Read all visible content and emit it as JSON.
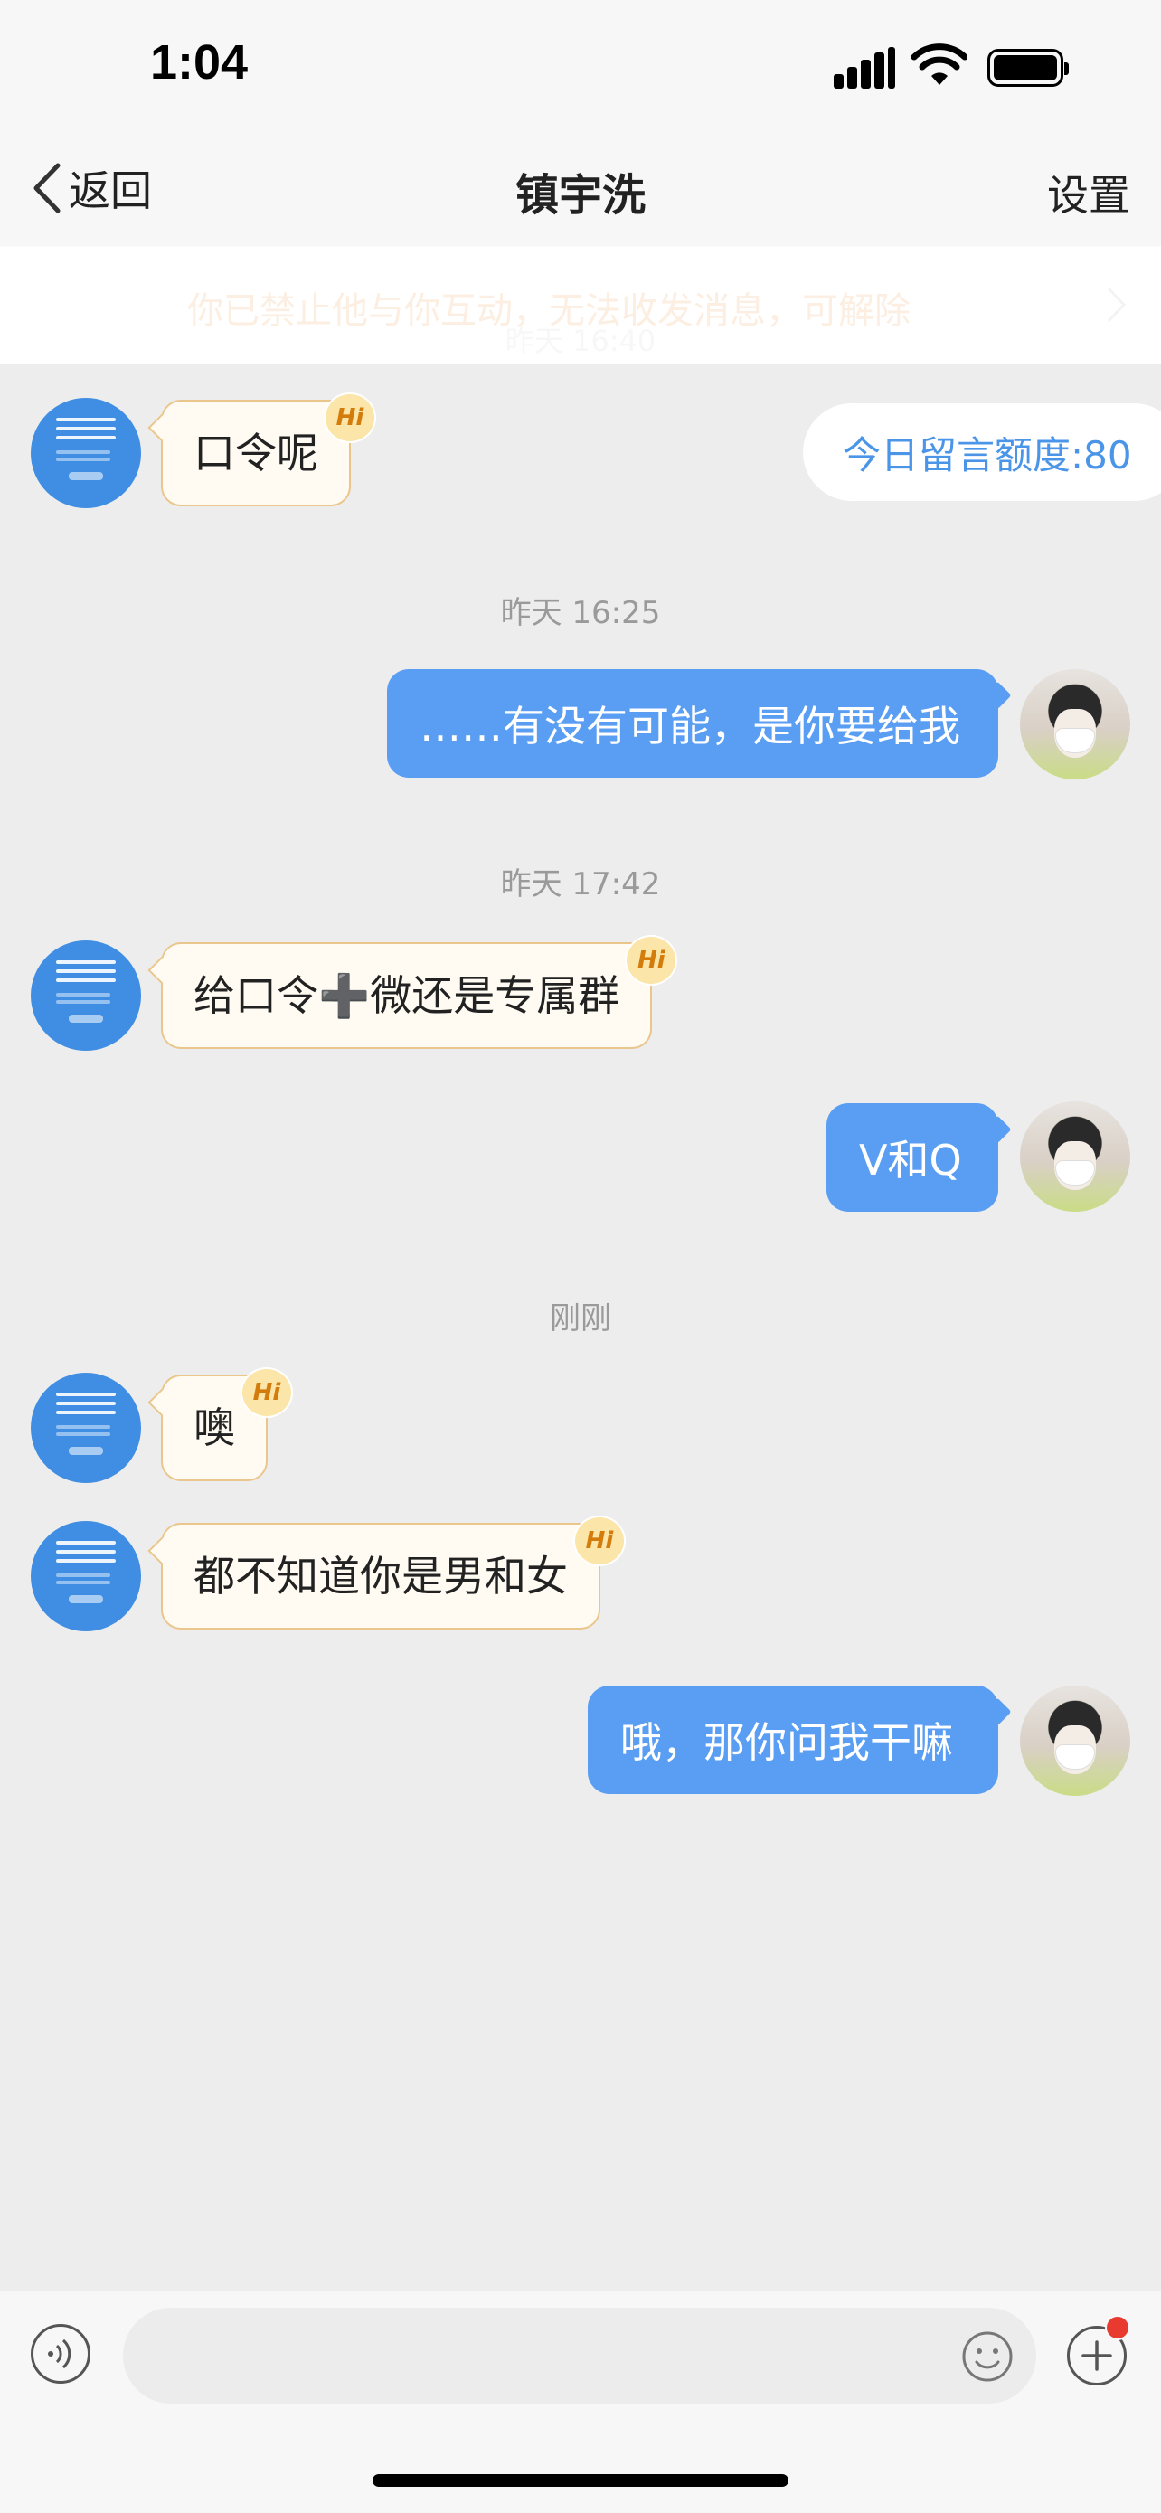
{
  "status_bar": {
    "time": "1:04",
    "icons": [
      "signal-icon",
      "wifi-icon",
      "battery-icon"
    ]
  },
  "nav": {
    "back_label": "返回",
    "title": "镇宇洗",
    "settings_label": "设置"
  },
  "banner": {
    "text": "你已禁止他与你互动，无法收发消息，可解除",
    "hidden_timestamp": "昨天 16:40"
  },
  "quota": {
    "text": "今日留言额度:80"
  },
  "messages": [
    {
      "side": "in",
      "text": "口令呢",
      "badge": "Hi"
    },
    {
      "side": "timestamp",
      "text": "昨天 16:25"
    },
    {
      "side": "out",
      "text": "……有没有可能，是你要给我"
    },
    {
      "side": "timestamp",
      "text": "昨天 17:42"
    },
    {
      "side": "in",
      "text": "给口令➕微还是专属群",
      "badge": "Hi"
    },
    {
      "side": "out",
      "text": "V和Q"
    },
    {
      "side": "timestamp",
      "text": "刚刚"
    },
    {
      "side": "in",
      "text": "噢",
      "badge": "Hi"
    },
    {
      "side": "in",
      "text": "都不知道你是男和女",
      "badge": "Hi"
    },
    {
      "side": "out",
      "text": "哦，那你问我干嘛"
    }
  ],
  "input_bar": {
    "placeholder": "",
    "icons": [
      "voice-icon",
      "emoji-icon",
      "plus-icon"
    ]
  },
  "colors": {
    "accent_blue": "#5a9ef3",
    "banner_orange": "#e8872b",
    "badge_gold": "#d37c0b",
    "notification_red": "#e83a2f"
  }
}
